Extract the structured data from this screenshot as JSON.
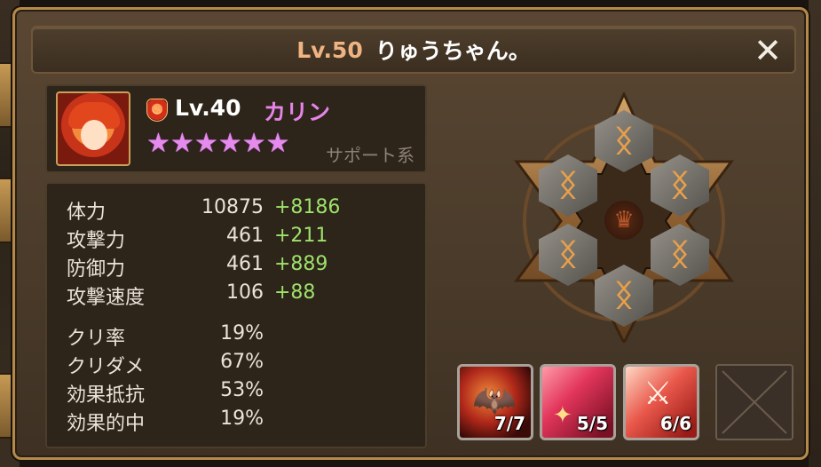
{
  "header": {
    "level": "Lv.50",
    "player_name": "りゅうちゃん。",
    "close_symbol": "✕"
  },
  "monster": {
    "element_icon": "fire-element-icon",
    "level": "Lv.40",
    "name": "カリン",
    "stars": [
      "★",
      "★",
      "★",
      "★",
      "★",
      "★"
    ],
    "star_color": "#e58bec",
    "role": "サポート系"
  },
  "stats": {
    "main": [
      {
        "label": "体力",
        "value": "10875",
        "bonus": "+8186"
      },
      {
        "label": "攻撃力",
        "value": "461",
        "bonus": "+211"
      },
      {
        "label": "防御力",
        "value": "461",
        "bonus": "+889"
      },
      {
        "label": "攻撃速度",
        "value": "106",
        "bonus": "+88"
      }
    ],
    "sub": [
      {
        "label": "クリ率",
        "value": "19%"
      },
      {
        "label": "クリダメ",
        "value": "67%"
      },
      {
        "label": "効果抵抗",
        "value": "53%"
      },
      {
        "label": "効果的中",
        "value": "19%"
      }
    ],
    "bonus_color": "#9ee26b"
  },
  "runes": {
    "slot_icon": "empty-rune-slot-icon",
    "center_icon": "helmet-emblem-icon",
    "slots": 6
  },
  "skills": [
    {
      "icon": "fire-bat-skill-icon",
      "level": "7/7"
    },
    {
      "icon": "feather-wand-skill-icon",
      "level": "5/5"
    },
    {
      "icon": "sword-break-skill-icon",
      "level": "6/6"
    },
    {
      "icon": "empty-skill-slot-icon",
      "level": ""
    }
  ]
}
